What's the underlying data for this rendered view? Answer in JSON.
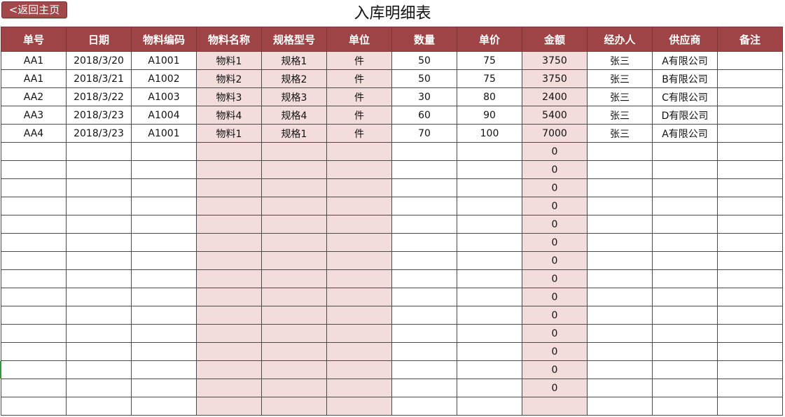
{
  "nav": {
    "back_label": "<返回主页"
  },
  "title": "入库明细表",
  "colors": {
    "header_bg": "#9e4446",
    "highlight_col": "#f2dcdc",
    "back_button": "#a0484a"
  },
  "table": {
    "headers": [
      "单号",
      "日期",
      "物料编码",
      "物料名称",
      "规格型号",
      "单位",
      "数量",
      "单价",
      "金额",
      "经办人",
      "供应商",
      "备注"
    ],
    "highlight_columns": [
      3,
      4,
      5,
      8
    ],
    "rows": [
      [
        "AA1",
        "2018/3/20",
        "A1001",
        "物料1",
        "规格1",
        "件",
        "50",
        "75",
        "3750",
        "张三",
        "A有限公司",
        ""
      ],
      [
        "AA1",
        "2018/3/21",
        "A1002",
        "物料2",
        "规格2",
        "件",
        "50",
        "75",
        "3750",
        "张三",
        "B有限公司",
        ""
      ],
      [
        "AA2",
        "2018/3/22",
        "A1003",
        "物料3",
        "规格3",
        "件",
        "30",
        "80",
        "2400",
        "张三",
        "C有限公司",
        ""
      ],
      [
        "AA3",
        "2018/3/23",
        "A1004",
        "物料4",
        "规格4",
        "件",
        "60",
        "90",
        "5400",
        "张三",
        "D有限公司",
        ""
      ],
      [
        "AA4",
        "2018/3/23",
        "A1001",
        "物料1",
        "规格1",
        "件",
        "70",
        "100",
        "7000",
        "张三",
        "A有限公司",
        ""
      ],
      [
        "",
        "",
        "",
        "",
        "",
        "",
        "",
        "",
        "0",
        "",
        "",
        ""
      ],
      [
        "",
        "",
        "",
        "",
        "",
        "",
        "",
        "",
        "0",
        "",
        "",
        ""
      ],
      [
        "",
        "",
        "",
        "",
        "",
        "",
        "",
        "",
        "0",
        "",
        "",
        ""
      ],
      [
        "",
        "",
        "",
        "",
        "",
        "",
        "",
        "",
        "0",
        "",
        "",
        ""
      ],
      [
        "",
        "",
        "",
        "",
        "",
        "",
        "",
        "",
        "0",
        "",
        "",
        ""
      ],
      [
        "",
        "",
        "",
        "",
        "",
        "",
        "",
        "",
        "0",
        "",
        "",
        ""
      ],
      [
        "",
        "",
        "",
        "",
        "",
        "",
        "",
        "",
        "0",
        "",
        "",
        ""
      ],
      [
        "",
        "",
        "",
        "",
        "",
        "",
        "",
        "",
        "0",
        "",
        "",
        ""
      ],
      [
        "",
        "",
        "",
        "",
        "",
        "",
        "",
        "",
        "0",
        "",
        "",
        ""
      ],
      [
        "",
        "",
        "",
        "",
        "",
        "",
        "",
        "",
        "0",
        "",
        "",
        ""
      ],
      [
        "",
        "",
        "",
        "",
        "",
        "",
        "",
        "",
        "0",
        "",
        "",
        ""
      ],
      [
        "",
        "",
        "",
        "",
        "",
        "",
        "",
        "",
        "0",
        "",
        "",
        ""
      ],
      [
        "",
        "",
        "",
        "",
        "",
        "",
        "",
        "",
        "0",
        "",
        "",
        ""
      ],
      [
        "",
        "",
        "",
        "",
        "",
        "",
        "",
        "",
        "0",
        "",
        "",
        ""
      ],
      [
        "",
        "",
        "",
        "",
        "",
        "",
        "",
        "",
        "",
        "",
        "",
        ""
      ]
    ]
  }
}
